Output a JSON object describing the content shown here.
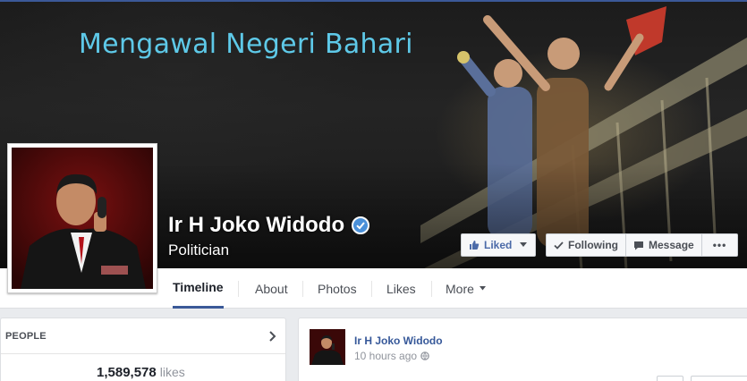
{
  "cover": {
    "title": "Mengawal Negeri Bahari"
  },
  "page": {
    "name": "Ir H Joko Widodo",
    "category": "Politician"
  },
  "actions": {
    "liked_label": "Liked",
    "following_label": "Following",
    "message_label": "Message",
    "more_label": "•••"
  },
  "tabs": [
    {
      "label": "Timeline"
    },
    {
      "label": "About"
    },
    {
      "label": "Photos"
    },
    {
      "label": "Likes"
    },
    {
      "label": "More"
    }
  ],
  "people_card": {
    "header": "PEOPLE",
    "likes_count": "1,589,578",
    "likes_label": "likes"
  },
  "post": {
    "author": "Ir H Joko Widodo",
    "time": "10 hours ago"
  },
  "colors": {
    "accent": "#3b5998",
    "verified": "#4a90d9",
    "cover_title": "#5ec9e8"
  }
}
